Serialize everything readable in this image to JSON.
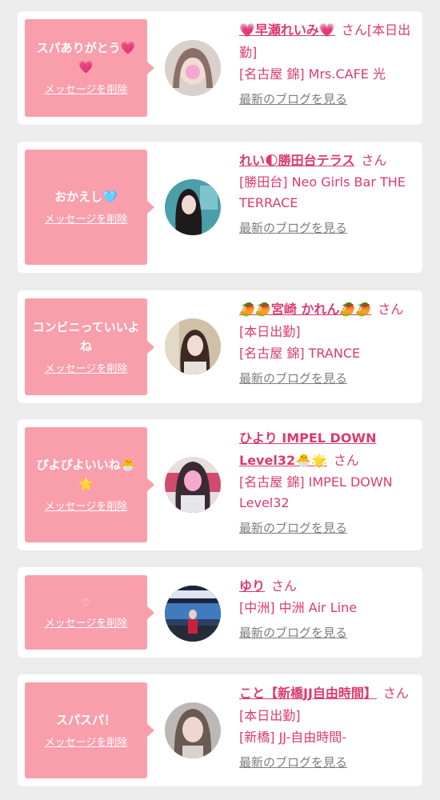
{
  "delete_label": "メッセージを削除",
  "blog_label": "最新のブログを見る",
  "san_label": "さん",
  "colors": {
    "page_bg": "#ececec",
    "card_bg": "#ffffff",
    "bubble_bg": "#f99eab",
    "accent": "#dc3a6f",
    "muted": "#7d7d7d"
  },
  "items": [
    {
      "message": "スパありがとう💗💗",
      "name": "💗早瀬れいみ💗",
      "today_tag": "[本日出勤]",
      "location": "[名古屋 錦] Mrs.CAFE 光",
      "avatar_icon": "photo-avatar-light"
    },
    {
      "message": "おかえし🩵",
      "name": "れい🌓勝田台テラス",
      "today_tag": "",
      "location": "[勝田台] Neo Girls Bar THE TERRACE",
      "avatar_icon": "photo-avatar-teal"
    },
    {
      "message": "コンビニっていいよね",
      "name": "🥭🥭宮崎 かれん🥭🥭",
      "today_tag": "[本日出勤]",
      "location": "[名古屋 錦] TRANCE",
      "avatar_icon": "photo-avatar-beige"
    },
    {
      "message": "ぴよぴよいいね🐣🌟",
      "name": "ひより IMPEL DOWN Level32🐣🌟",
      "today_tag": "",
      "location": "[名古屋 錦] IMPEL DOWN Level32",
      "avatar_icon": "photo-avatar-cafe-sign"
    },
    {
      "message": "♡",
      "name": "ゆり",
      "today_tag": "",
      "location": "[中洲] 中洲 Air Line",
      "avatar_icon": "photo-avatar-airline-stage"
    },
    {
      "message": "スパスパ！",
      "name": "こと【新橋JJ自由時間】",
      "today_tag": "[本日出勤]",
      "location": "[新橋] JJ-自由時間-",
      "avatar_icon": "photo-avatar-grey"
    }
  ]
}
